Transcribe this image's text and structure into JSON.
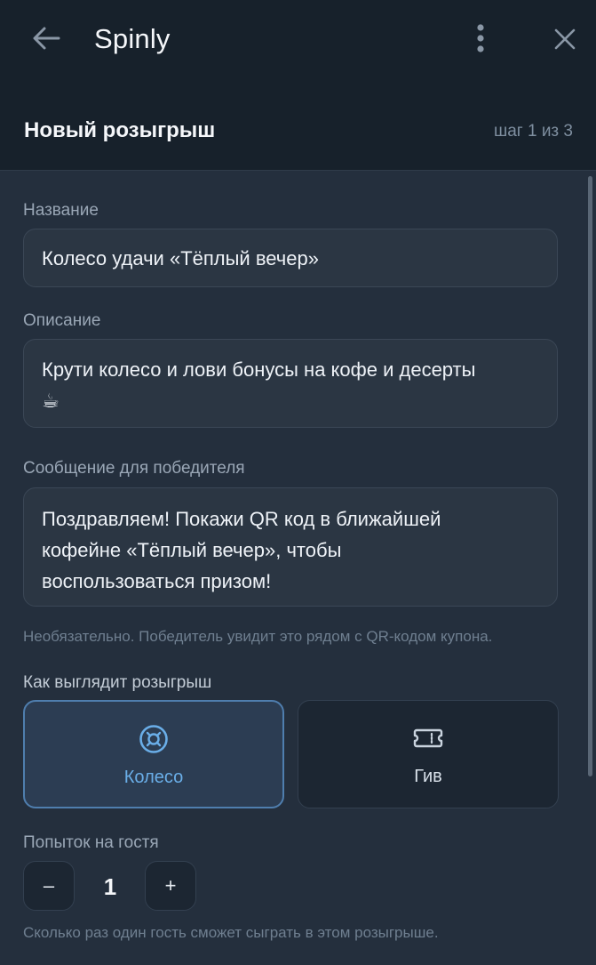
{
  "app": {
    "title": "Spinly"
  },
  "header": {
    "title": "Новый розыгрыш",
    "step": "шаг 1 из 3"
  },
  "form": {
    "name": {
      "label": "Название",
      "value": "Колесо удачи «Тёплый вечер»"
    },
    "description": {
      "label": "Описание",
      "line1": "Крути колесо и лови бонусы на кофе и десерты",
      "line2": "☕"
    },
    "winner_message": {
      "label": "Сообщение для победителя",
      "line1": "Поздравляем! Покажи QR код в ближайшей",
      "line2": "кофейне «Тёплый вечер», чтобы",
      "line3": "воспользоваться призом!",
      "hint": "Необязательно. Победитель увидит это рядом с QR-кодом купона."
    },
    "appearance": {
      "label": "Как выглядит розыгрыш",
      "options": [
        {
          "label": "Колесо",
          "icon": "wheel-icon",
          "selected": true
        },
        {
          "label": "Гив",
          "icon": "ticket-icon",
          "selected": false
        }
      ]
    },
    "attempts": {
      "label": "Попыток на гостя",
      "minus": "–",
      "value": "1",
      "plus": "+",
      "hint": "Сколько раз один гость сможет сыграть в этом розыгрыше."
    }
  },
  "colors": {
    "accent": "#6aaee8",
    "background": "#242f3d",
    "topbar": "#17212b"
  }
}
